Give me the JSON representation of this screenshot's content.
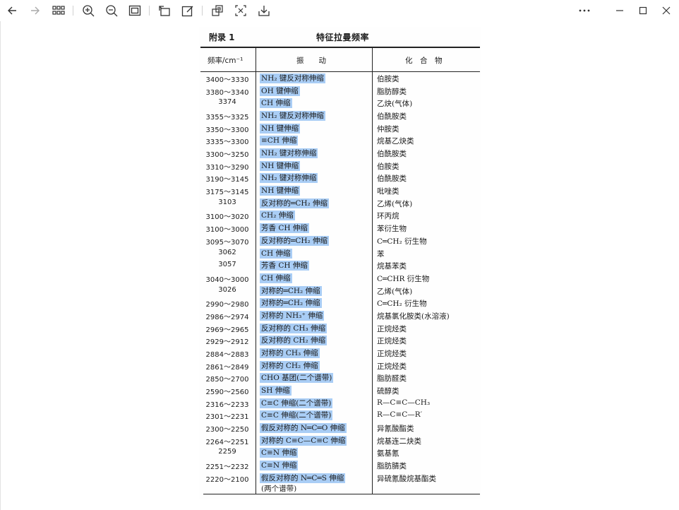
{
  "toolbar": {
    "icons": [
      "back-arrow-icon",
      "forward-arrow-icon",
      "grid-icon",
      "zoom-in-icon",
      "zoom-out-icon",
      "fit-page-icon",
      "rotate-icon",
      "edit-icon",
      "crop-icon",
      "scan-icon",
      "download-icon",
      "more-icon",
      "minimize-icon",
      "maximize-icon",
      "close-icon"
    ]
  },
  "document": {
    "appendix_label": "附录 1",
    "title": "特征拉曼频率",
    "col_freq": "频率/cm⁻¹",
    "col_vib": "振　　动",
    "col_cmp": "化　合　物",
    "rows": [
      {
        "freq": "3400～3330",
        "vib": "NH₂ 键反对称伸缩",
        "cmp": "伯胺类"
      },
      {
        "freq": "3380～3340",
        "vib": "OH 键伸缩",
        "cmp": "脂肪醇类"
      },
      {
        "freq": "3374",
        "vib": "CH 伸缩",
        "cmp": "乙炔(气体)"
      },
      {
        "freq": "3355～3325",
        "vib": "NH₂ 键反对称伸缩",
        "cmp": "伯酰胺类"
      },
      {
        "freq": "3350～3300",
        "vib": "NH 键伸缩",
        "cmp": "仲胺类"
      },
      {
        "freq": "3335～3300",
        "vib": "≡CH 伸缩",
        "cmp": "烷基乙炔类"
      },
      {
        "freq": "3300～3250",
        "vib": "NH₂ 键对称伸缩",
        "cmp": "伯酰胺类"
      },
      {
        "freq": "3310～3290",
        "vib": "NH 键伸缩",
        "cmp": "伯胺类"
      },
      {
        "freq": "3190～3145",
        "vib": "NH₂ 键对称伸缩",
        "cmp": "伯酰胺类"
      },
      {
        "freq": "3175～3145",
        "vib": "NH 键伸缩",
        "cmp": "吡唑类"
      },
      {
        "freq": "3103",
        "vib": "反对称的═CH₂ 伸缩",
        "cmp": "乙烯(气体)"
      },
      {
        "freq": "3100～3020",
        "vib": "CH₂ 伸缩",
        "cmp": "环丙烷"
      },
      {
        "freq": "3100～3000",
        "vib": "芳香 CH 伸缩",
        "cmp": "苯衍生物"
      },
      {
        "freq": "3095～3070",
        "vib": "反对称的═CH₂ 伸缩",
        "cmp": "C═CH₂ 衍生物"
      },
      {
        "freq": "3062",
        "vib": "CH 伸缩",
        "cmp": "苯"
      },
      {
        "freq": "3057",
        "vib": "芳香 CH 伸缩",
        "cmp": "烷基苯类"
      },
      {
        "freq": "3040～3000",
        "vib": "CH 伸缩",
        "cmp": "C═CHR 衍生物"
      },
      {
        "freq": "3026",
        "vib": "对称的═CH₂ 伸缩",
        "cmp": "乙烯(气体)"
      },
      {
        "freq": "2990～2980",
        "vib": "对称的═CH₂ 伸缩",
        "cmp": "C═CH₂ 衍生物"
      },
      {
        "freq": "2986～2974",
        "vib": "对称的 NH₃⁺ 伸缩",
        "cmp": "烷基氯化胺类(水溶液)"
      },
      {
        "freq": "2969～2965",
        "vib": "反对称的 CH₃ 伸缩",
        "cmp": "正烷烃类"
      },
      {
        "freq": "2929～2912",
        "vib": "反对称的 CH₂ 伸缩",
        "cmp": "正烷烃类"
      },
      {
        "freq": "2884～2883",
        "vib": "对称的 CH₃ 伸缩",
        "cmp": "正烷烃类"
      },
      {
        "freq": "2861～2849",
        "vib": "对称的 CH₂ 伸缩",
        "cmp": "正烷烃类"
      },
      {
        "freq": "2850～2700",
        "vib": "CHO 基团(二个谱带)",
        "cmp": "脂肪醛类"
      },
      {
        "freq": "2590～2560",
        "vib": "SH 伸缩",
        "cmp": "硫醇类"
      },
      {
        "freq": "2316～2233",
        "vib": "C≡C 伸缩(二个谱带)",
        "cmp": "R—C≡C—CH₃"
      },
      {
        "freq": "2301～2231",
        "vib": "C≡C 伸缩(二个谱带)",
        "cmp": "R—C≡C—R′"
      },
      {
        "freq": "2300～2250",
        "vib": "假反对称的 N═C═O 伸缩",
        "cmp": "异氰酸酯类"
      },
      {
        "freq": "2264～2251",
        "vib": "对称的 C≡C—C≡C 伸缩",
        "cmp": "烷基连二炔类"
      },
      {
        "freq": "2259",
        "vib": "C≡N 伸缩",
        "cmp": "氨基氰"
      },
      {
        "freq": "2251～2232",
        "vib": "C≡N 伸缩",
        "cmp": "脂肪腈类"
      },
      {
        "freq": "2220～2100",
        "vib": "假反对称的 N═C═S 伸缩",
        "cmp": "异硫氰酸烷基酯类"
      }
    ],
    "continuation": "(两个谱带)"
  }
}
